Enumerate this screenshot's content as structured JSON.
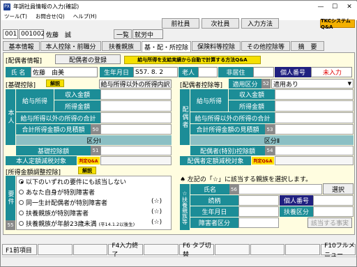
{
  "window": {
    "title": "年調社員情報の入力(確認)",
    "app_icon": "PX",
    "min": "—",
    "max": "☐",
    "close": "✕"
  },
  "menu": [
    "ツール(T)",
    "お問合せ(Q)",
    "ヘルプ(H)"
  ],
  "top_nav": {
    "prev": "前社員",
    "next": "次社員",
    "input_method": "入力方法",
    "tkc_qa": "TKCシステムQ&A"
  },
  "employee": {
    "dept": "001",
    "code": "001002",
    "name": "佐藤　誠",
    "list_btn": "一覧",
    "status": "就労中"
  },
  "tabs": [
    "基本情報",
    "本人控除・前職分",
    "扶養親族",
    "基・配・所控除",
    "保険料等控除",
    "その他控除等",
    "摘　要"
  ],
  "spouse": {
    "section": "[配偶者情報]",
    "register_btn": "配偶者の登録",
    "auto_calc_btn": "給与所得を支給実績から自動で計算する方法Q&A",
    "name_label": "氏 名",
    "name_value": "佐藤　由美",
    "birth_label": "生年月日",
    "birth_value": "S57. 8. 2",
    "elderly_label": "老人",
    "nonresident_label": "非居住",
    "mynumber_label": "個人番号",
    "mynumber_value": "未入力"
  },
  "basic": {
    "section": "[基礎控除]",
    "help": "解説",
    "other_income_btn": "給与所得以外の所得内訳",
    "side_label": "本人",
    "salary_label": "給与所得",
    "income_label": "収入金額",
    "amount_label": "所得金額",
    "other_total": "給与所得以外の所得の合計",
    "estimate": "合計所得金額の見積額",
    "est_no": "50",
    "class_label": "区分Ⅰ",
    "deduction_label": "基礎控除額",
    "ded_no": "51",
    "tax_reduction": "本人定額減税対象",
    "hantei": "判定Q&A"
  },
  "spouse_ded": {
    "section": "[配偶者控除等]",
    "applicable_label": "適用区分",
    "applicable_no": "52",
    "applicable_value": "適用あり",
    "side_label": "配偶者",
    "salary_label": "給与所得",
    "income_label": "収入金額",
    "amount_label": "所得金額",
    "other_total": "給与所得以外の所得の合計",
    "estimate": "合計所得金額の見積額",
    "est_no": "53",
    "class_label": "区分Ⅱ",
    "deduction_label": "配偶者(特別)控除額",
    "ded_no": "54",
    "tax_reduction": "配偶者定額減税対象",
    "hantei": "判定Q&A"
  },
  "adjust": {
    "section": "[所得金額調整控除]",
    "help": "解説",
    "side_label": "要件",
    "no": "55",
    "options": [
      {
        "label": "以下のいずれの要件にも該当しない",
        "mark": "",
        "selected": true
      },
      {
        "label": "あなた自身が特別障害者",
        "mark": "",
        "selected": false
      },
      {
        "label": "同一生計配偶者が特別障害者",
        "mark": "(☆)",
        "selected": false
      },
      {
        "label": "扶養親族が特別障害者",
        "mark": "(☆)",
        "selected": false
      },
      {
        "label": "扶養親族が年齢23歳未満",
        "note": "(平14.1.2以後生)",
        "mark": "(☆)",
        "selected": false
      }
    ]
  },
  "dependent": {
    "prompt": "♠ 左記の「☆」に該当する親族を選択します。",
    "side_label": "☆扶養親族等",
    "name_label": "氏名",
    "name_no": "56",
    "select_btn": "選択",
    "relation_label": "続柄",
    "mynumber_label": "個人番号",
    "birth_label": "生年月日",
    "dep_class_label": "扶養区分",
    "disability_label": "障害者区分",
    "applicable_btn": "該当する事実"
  },
  "fkeys": [
    "F1前項目",
    "",
    "",
    "F4入力終了",
    "",
    "F6 タブ切替",
    "",
    "",
    "",
    "F10フルメニュー"
  ]
}
